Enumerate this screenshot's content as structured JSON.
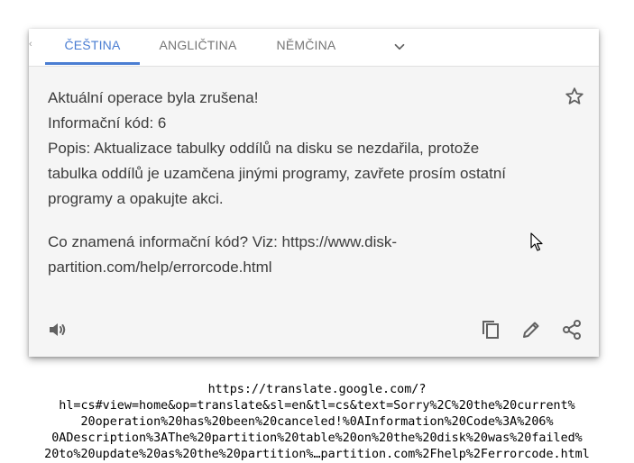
{
  "tabs": {
    "items": [
      {
        "label": "ČEŠTINA",
        "active": true
      },
      {
        "label": "ANGLIČTINA",
        "active": false
      },
      {
        "label": "NĚMČINA",
        "active": false
      }
    ],
    "more_icon": "chevron-down-icon",
    "accent_color": "#4a7dd2"
  },
  "translation": {
    "lines": [
      "Aktuální operace byla zrušena!",
      "Informační kód: 6",
      "Popis: Aktualizace tabulky oddílů na disku se nezdařila, protože",
      "tabulka oddílů je uzamčena jinými programy, zavřete prosím ostatní",
      "programy a opakujte akci.",
      "Co znamená informační kód? Viz: https://www.disk-",
      "partition.com/help/errorcode.html"
    ],
    "star_icon": "star-outline-icon"
  },
  "actions": {
    "listen_icon": "speaker-icon",
    "copy_icon": "copy-icon",
    "edit_icon": "pencil-icon",
    "share_icon": "share-icon"
  },
  "url_text": {
    "lines": [
      "https://translate.google.com/?",
      "hl=cs#view=home&op=translate&sl=en&tl=cs&text=Sorry%2C%20the%20current%",
      "20operation%20has%20been%20canceled!%0AInformation%20Code%3A%206%",
      "0ADescription%3AThe%20partition%20table%20on%20the%20disk%20was%20failed%",
      "20to%20update%20as%20the%20partition%…partition.com%2Fhelp%2Ferrorcode.html"
    ]
  }
}
